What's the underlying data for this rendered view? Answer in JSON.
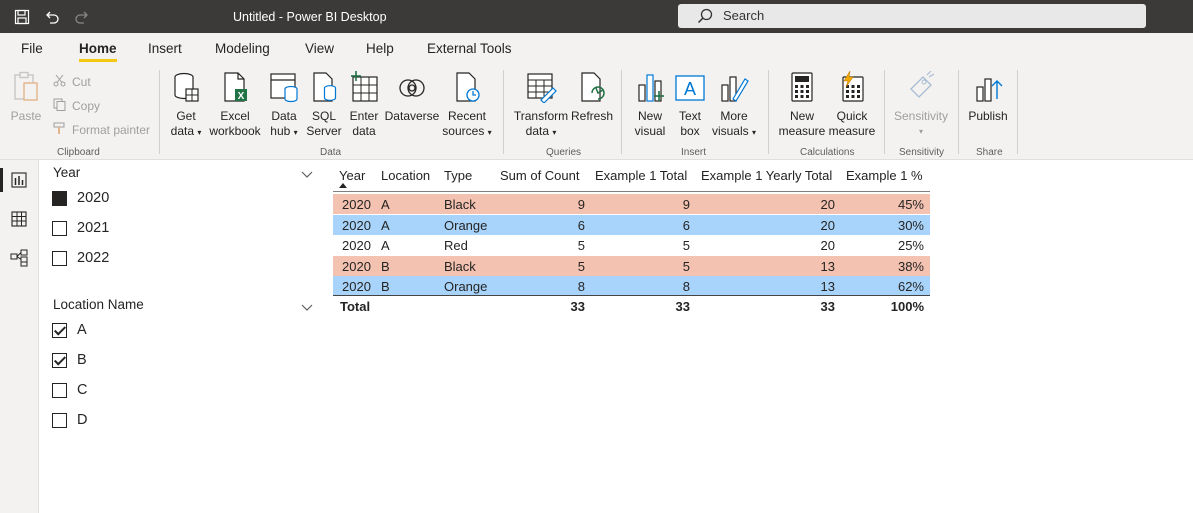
{
  "window": {
    "title": "Untitled - Power BI Desktop",
    "search_placeholder": "Search"
  },
  "menu": {
    "tabs": [
      {
        "label": "File"
      },
      {
        "label": "Home",
        "active": true
      },
      {
        "label": "Insert"
      },
      {
        "label": "Modeling"
      },
      {
        "label": "View"
      },
      {
        "label": "Help"
      },
      {
        "label": "External Tools"
      }
    ]
  },
  "ribbon": {
    "clipboard": {
      "paste": "Paste",
      "cut": "Cut",
      "copy": "Copy",
      "format_painter": "Format painter",
      "label": "Clipboard"
    },
    "data": {
      "get_data_1": "Get",
      "get_data_2": "data",
      "excel_1": "Excel",
      "excel_2": "workbook",
      "datahub_1": "Data",
      "datahub_2": "hub",
      "sql_1": "SQL",
      "sql_2": "Server",
      "enter_1": "Enter",
      "enter_2": "data",
      "dataverse": "Dataverse",
      "recent_1": "Recent",
      "recent_2": "sources",
      "label": "Data"
    },
    "queries": {
      "transform_1": "Transform",
      "transform_2": "data",
      "refresh": "Refresh",
      "label": "Queries"
    },
    "insert": {
      "newvisual_1": "New",
      "newvisual_2": "visual",
      "textbox_1": "Text",
      "textbox_2": "box",
      "more_1": "More",
      "more_2": "visuals",
      "label": "Insert"
    },
    "calculations": {
      "newmeasure_1": "New",
      "newmeasure_2": "measure",
      "quick_1": "Quick",
      "quick_2": "measure",
      "label": "Calculations"
    },
    "sensitivity": {
      "button": "Sensitivity",
      "label": "Sensitivity"
    },
    "share": {
      "publish": "Publish",
      "label": "Share"
    }
  },
  "slicers": {
    "year": {
      "title": "Year",
      "items": [
        {
          "label": "2020",
          "state": "filled"
        },
        {
          "label": "2021",
          "state": "empty"
        },
        {
          "label": "2022",
          "state": "empty"
        }
      ]
    },
    "location": {
      "title": "Location Name",
      "items": [
        {
          "label": "A",
          "state": "checked"
        },
        {
          "label": "B",
          "state": "checked"
        },
        {
          "label": "C",
          "state": "empty"
        },
        {
          "label": "D",
          "state": "empty"
        }
      ]
    }
  },
  "table": {
    "headers": [
      "Year",
      "Location",
      "Type",
      "Sum of Count",
      "Example 1 Total",
      "Example 1 Yearly Total",
      "Example 1 %"
    ],
    "rows": [
      {
        "year": "2020",
        "location": "A",
        "type": "Black",
        "sum": "9",
        "total": "9",
        "yearly": "20",
        "pct": "45%",
        "bg": "#f4c2b0"
      },
      {
        "year": "2020",
        "location": "A",
        "type": "Orange",
        "sum": "6",
        "total": "6",
        "yearly": "20",
        "pct": "30%",
        "bg": "#a8d4fb"
      },
      {
        "year": "2020",
        "location": "A",
        "type": "Red",
        "sum": "5",
        "total": "5",
        "yearly": "20",
        "pct": "25%",
        "bg": "#ffffff"
      },
      {
        "year": "2020",
        "location": "B",
        "type": "Black",
        "sum": "5",
        "total": "5",
        "yearly": "13",
        "pct": "38%",
        "bg": "#f4c2b0"
      },
      {
        "year": "2020",
        "location": "B",
        "type": "Orange",
        "sum": "8",
        "total": "8",
        "yearly": "13",
        "pct": "62%",
        "bg": "#a8d4fb"
      }
    ],
    "total_row": {
      "label": "Total",
      "sum": "33",
      "total": "33",
      "yearly": "33",
      "pct": "100%"
    }
  },
  "colors": {
    "titlebar": "#3b3a39",
    "accent": "#f2c811",
    "row_salmon": "#f4c2b0",
    "row_blue": "#a8d4fb"
  }
}
